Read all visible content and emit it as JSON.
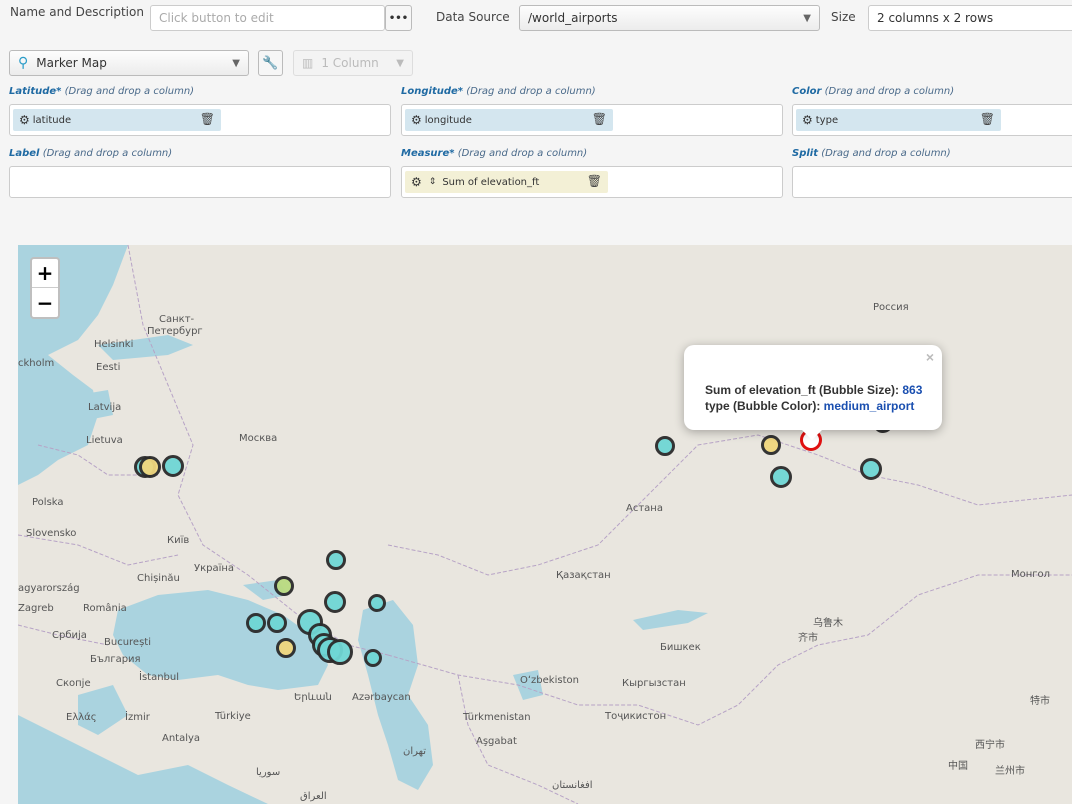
{
  "toolbar": {
    "name_label": "Name and Description",
    "name_placeholder": "Click button to edit",
    "more_label": "•••",
    "datasource_label": "Data Source",
    "datasource_value": "/world_airports",
    "size_label": "Size",
    "size_value": "2 columns x 2 rows",
    "chart_type": "Marker Map",
    "columns_value": "1 Column"
  },
  "fields": {
    "latitude": {
      "label": "Latitude*",
      "hint": "(Drag and drop a column)",
      "pill": "latitude"
    },
    "longitude": {
      "label": "Longitude*",
      "hint": "(Drag and drop a column)",
      "pill": "longitude"
    },
    "color": {
      "label": "Color",
      "hint": "(Drag and drop a column)",
      "pill": "type"
    },
    "label": {
      "label": "Label",
      "hint": "(Drag and drop a column)"
    },
    "measure": {
      "label": "Measure*",
      "hint": "(Drag and drop a column)",
      "pill": "Sum of elevation_ft"
    },
    "split": {
      "label": "Split",
      "hint": "(Drag and drop a column)"
    }
  },
  "map": {
    "zoom_in": "+",
    "zoom_out": "−",
    "place_labels": [
      {
        "text": "Россия"
      },
      {
        "text": "Санкт-"
      },
      {
        "text": "Петербург"
      },
      {
        "text": "Helsinki"
      },
      {
        "text": "ckholm"
      },
      {
        "text": "Eesti"
      },
      {
        "text": "Latvija"
      },
      {
        "text": "Lietuva"
      },
      {
        "text": "Москва"
      },
      {
        "text": "Polska"
      },
      {
        "text": "Київ"
      },
      {
        "text": "Slovensko"
      },
      {
        "text": "Україна"
      },
      {
        "text": "agyarország"
      },
      {
        "text": "Chișinău"
      },
      {
        "text": "Zagreb"
      },
      {
        "text": "România"
      },
      {
        "text": "Србија"
      },
      {
        "text": "București"
      },
      {
        "text": "България"
      },
      {
        "text": "Скопје"
      },
      {
        "text": "İstanbul"
      },
      {
        "text": "Ελλάς"
      },
      {
        "text": "İzmir"
      },
      {
        "text": "Türkiye"
      },
      {
        "text": "Antalya"
      },
      {
        "text": "Երևան"
      },
      {
        "text": "Azərbaycan"
      },
      {
        "text": "Türkmenistan"
      },
      {
        "text": "Aşgabat"
      },
      {
        "text": "Oʻzbekiston"
      },
      {
        "text": "Қазақстан"
      },
      {
        "text": "Астана"
      },
      {
        "text": "Бишкек"
      },
      {
        "text": "Кыргызстан"
      },
      {
        "text": "Тоҷикистон"
      },
      {
        "text": "Монгол"
      },
      {
        "text": "乌鲁木"
      },
      {
        "text": "齐市"
      },
      {
        "text": "西宁市"
      },
      {
        "text": "中国"
      },
      {
        "text": "兰州市"
      },
      {
        "text": "特市"
      },
      {
        "text": "تهران"
      },
      {
        "text": "سوريا"
      },
      {
        "text": "العراق"
      },
      {
        "text": "افغانستان"
      }
    ]
  },
  "popup": {
    "close": "×",
    "measure_label": "Sum of elevation_ft (Bubble Size):",
    "measure_value": "863",
    "color_label": "type (Bubble Color):",
    "color_value": "medium_airport"
  },
  "colors": {
    "medium_airport": "#6fd7d5",
    "small_airport": "#f0d77e",
    "large_airport": "#b9db81",
    "selected": "#e01010"
  }
}
